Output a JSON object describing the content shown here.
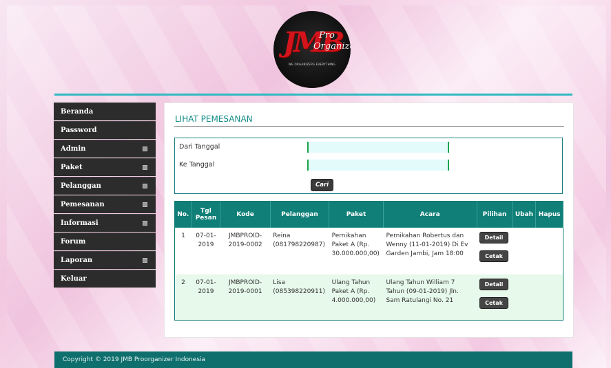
{
  "logo": {
    "mark": "JMB",
    "line1": "Pro",
    "line2": "Organizer",
    "tagline": "WE ORGANIZERS EVERYTHING"
  },
  "sidebar": {
    "items": [
      {
        "label": "Beranda",
        "has_arrow": false
      },
      {
        "label": "Password",
        "has_arrow": false
      },
      {
        "label": "Admin",
        "has_arrow": true
      },
      {
        "label": "Paket",
        "has_arrow": true
      },
      {
        "label": "Pelanggan",
        "has_arrow": true
      },
      {
        "label": "Pemesanan",
        "has_arrow": true
      },
      {
        "label": "Informasi",
        "has_arrow": true
      },
      {
        "label": "Forum",
        "has_arrow": false
      },
      {
        "label": "Laporan",
        "has_arrow": true
      },
      {
        "label": "Keluar",
        "has_arrow": false
      }
    ]
  },
  "main": {
    "title": "LIHAT PEMESANAN",
    "filter": {
      "from_label": "Dari Tanggal",
      "from_value": "",
      "to_label": "Ke Tanggal",
      "to_value": "",
      "search_button": "Cari"
    },
    "table": {
      "headers": [
        "No.",
        "Tgl Pesan",
        "Kode",
        "Pelanggan",
        "Paket",
        "Acara",
        "Pilihan",
        "Ubah",
        "Hapus"
      ],
      "rows": [
        {
          "no": "1",
          "tgl": "07-01-2019",
          "kode": "JMBPROID-2019-0002",
          "pelanggan": "Reina (081798220987)",
          "paket": "Pernikahan Paket A (Rp. 30.000.000,00)",
          "acara": "Pernikahan Robertus dan Wenny (11-01-2019) Di Ev Garden Jambi, Jam 18:00",
          "detail": "Detail",
          "cetak": "Cetak"
        },
        {
          "no": "2",
          "tgl": "07-01-2019",
          "kode": "JMBPROID-2019-0001",
          "pelanggan": "Lisa (085398220911)",
          "paket": "Ulang Tahun Paket A (Rp. 4.000.000,00)",
          "acara": "Ulang Tahun William 7 Tahun (09-01-2019) Jln. Sam Ratulangi No. 21",
          "detail": "Detail",
          "cetak": "Cetak"
        }
      ]
    }
  },
  "footer": {
    "text": "Copyright © 2019 JMB Proorganizer Indonesia"
  },
  "colors": {
    "accent": "#0f7f78",
    "topline": "#2fb8c2",
    "sidebar": "#2c2c2c",
    "title": "#0f8a86",
    "row_alt": "#e6f9ea"
  }
}
